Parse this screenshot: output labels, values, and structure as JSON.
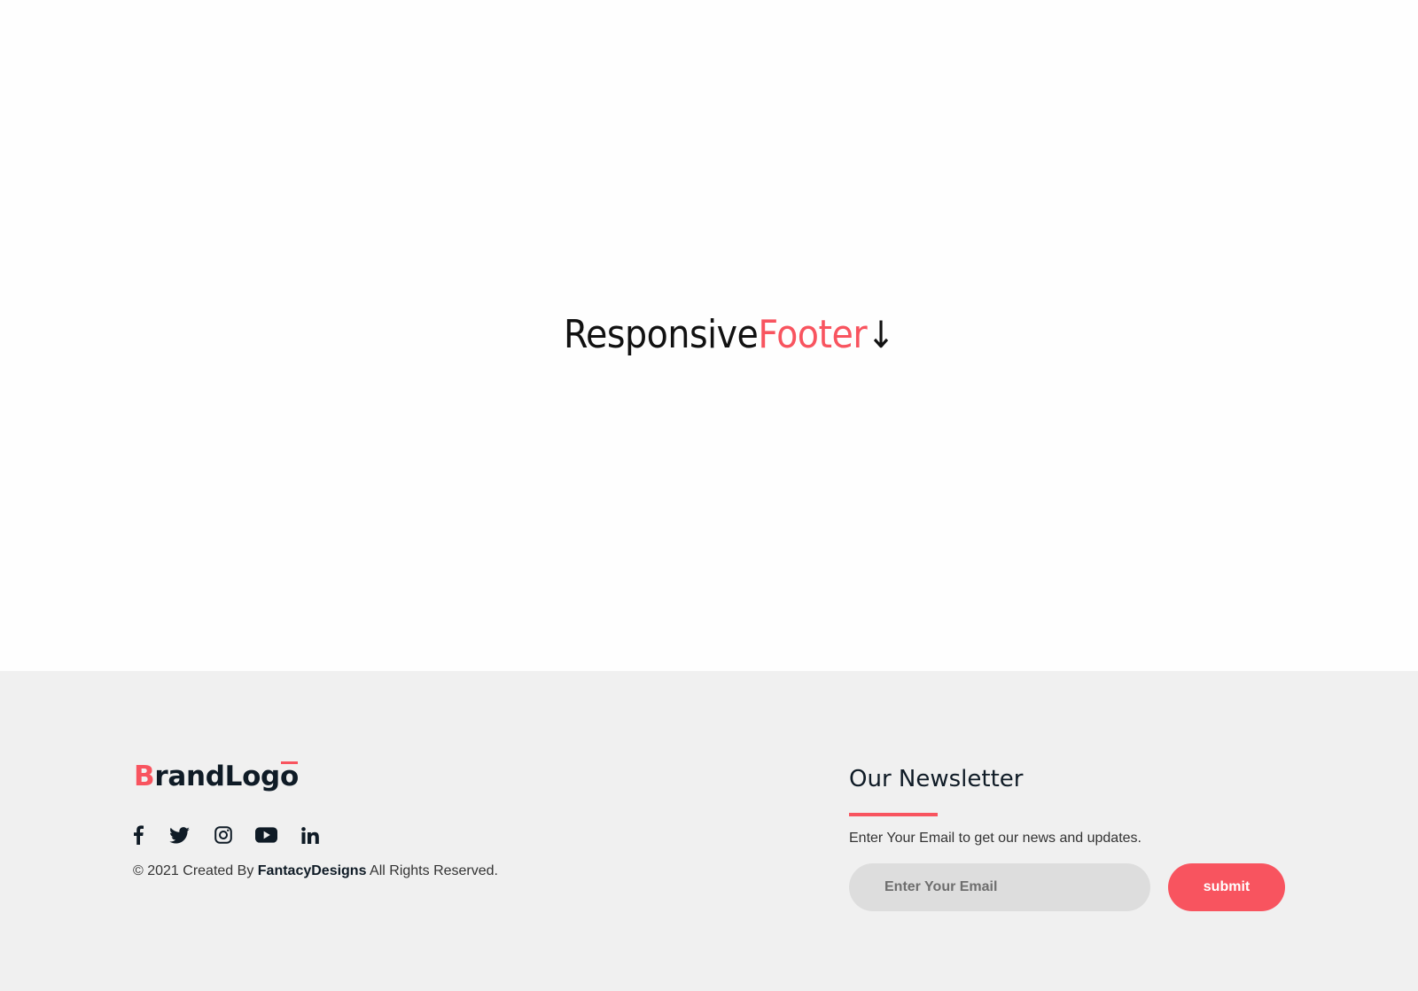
{
  "hero": {
    "title_part1": "Responsive",
    "title_part2": "Footer",
    "arrow": "↓"
  },
  "footer": {
    "brand": {
      "first_letter": "B",
      "middle": "randLog",
      "last_letter": "o"
    },
    "socials": [
      {
        "name": "facebook",
        "icon": "facebook-icon"
      },
      {
        "name": "twitter",
        "icon": "twitter-icon"
      },
      {
        "name": "instagram",
        "icon": "instagram-icon"
      },
      {
        "name": "youtube",
        "icon": "youtube-icon"
      },
      {
        "name": "linkedin",
        "icon": "linkedin-icon"
      }
    ],
    "copyright": {
      "prefix": "© 2021 Created By ",
      "author": "FantacyDesigns",
      "suffix": " All Rights Reserved."
    },
    "newsletter": {
      "title": "Our Newsletter",
      "description": "Enter Your Email to get our news and updates.",
      "email_placeholder": "Enter Your Email",
      "submit_label": "submit"
    }
  },
  "colors": {
    "accent": "#f8545f",
    "dark": "#0f1b26",
    "footer_bg": "#f0f0f0",
    "input_bg": "#dddddd"
  }
}
